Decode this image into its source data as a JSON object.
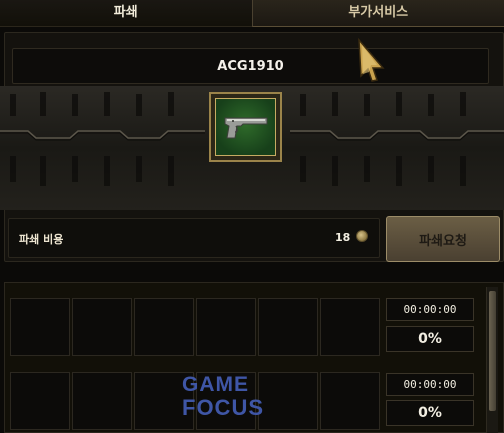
{
  "tabs": [
    {
      "label": "파쇄",
      "active": true
    },
    {
      "label": "부가서비스",
      "active": false
    }
  ],
  "item": {
    "name": "ACG1910",
    "icon": "pistol-icon"
  },
  "cost": {
    "label": "파쇄 비용",
    "value": "18",
    "icon": "coin-icon"
  },
  "request_button": {
    "label": "파쇄요청"
  },
  "queue": [
    {
      "time": "00:00:00",
      "percent": "0%"
    },
    {
      "time": "00:00:00",
      "percent": "0%"
    }
  ],
  "watermark": {
    "line1": "GAME",
    "line2": "FOCUS"
  },
  "colors": {
    "gold_border": "#9b844a",
    "panel_bg": "#14120e",
    "button_bg": "#5a4e3a",
    "watermark_blue": "#3f56a6"
  }
}
